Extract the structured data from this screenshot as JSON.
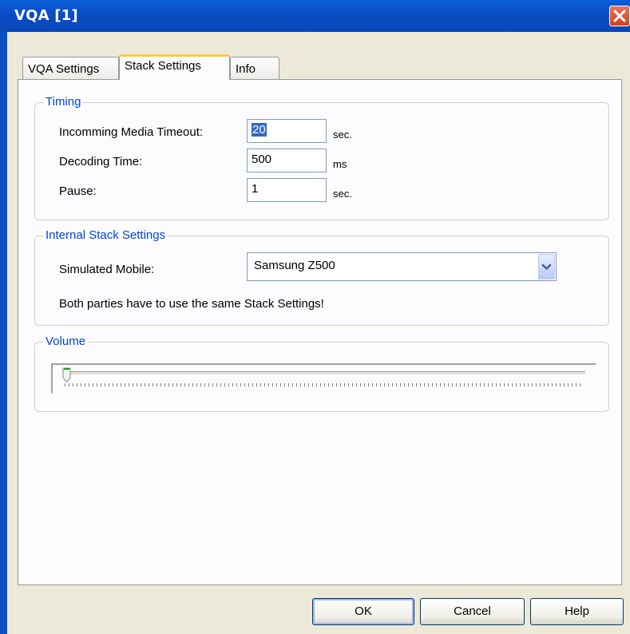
{
  "window": {
    "title": "VQA [1]"
  },
  "tabs": [
    {
      "label": "VQA Settings"
    },
    {
      "label": "Stack Settings"
    },
    {
      "label": "Info"
    }
  ],
  "active_tab": "Stack Settings",
  "timing": {
    "legend": "Timing",
    "incoming_label": "Incomming Media Timeout:",
    "incoming_value": "20",
    "incoming_unit": "sec.",
    "decoding_label": "Decoding Time:",
    "decoding_value": "500",
    "decoding_unit": "ms",
    "pause_label": "Pause:",
    "pause_value": "1",
    "pause_unit": "sec."
  },
  "stack": {
    "legend": "Internal Stack Settings",
    "mobile_label": "Simulated Mobile:",
    "mobile_value": "Samsung Z500",
    "note": "Both parties have to use the same Stack Settings!"
  },
  "volume": {
    "legend": "Volume",
    "level": 0
  },
  "buttons": {
    "ok": "OK",
    "cancel": "Cancel",
    "help": "Help"
  },
  "colors": {
    "titlebar": "#0b4cc4",
    "group_title": "#0046d5",
    "active_tab_accent": "#ffc83c",
    "close_button": "#d2401e"
  }
}
